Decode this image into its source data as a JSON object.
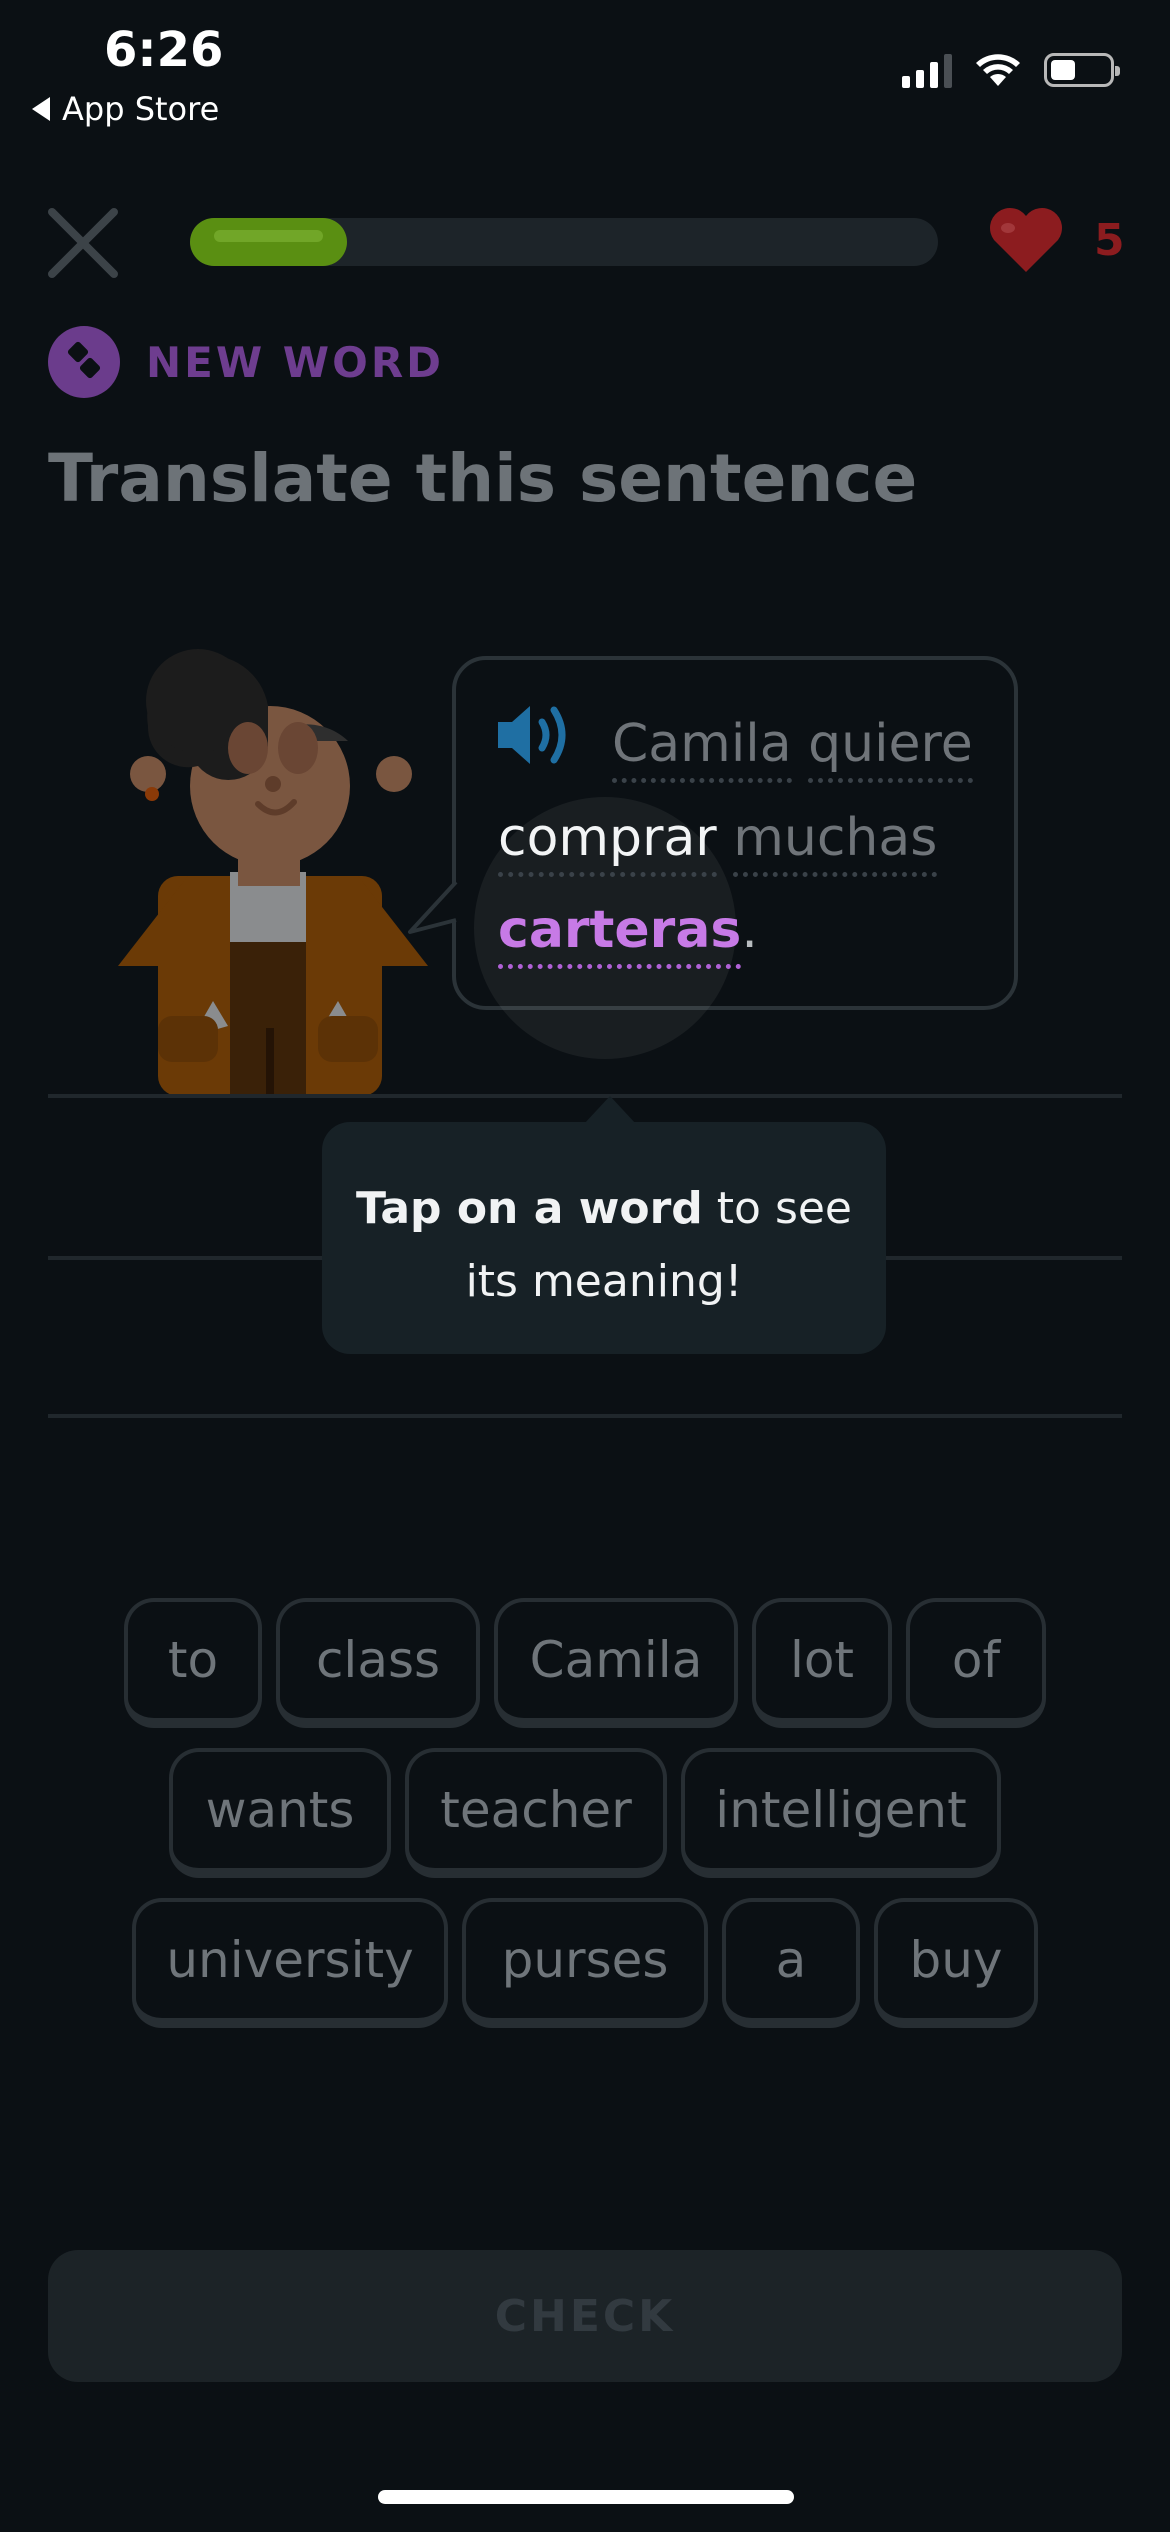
{
  "status_bar": {
    "time": "6:26",
    "back_label": "App Store",
    "icons": [
      "cellular-signal-icon",
      "wifi-icon",
      "battery-icon"
    ]
  },
  "header": {
    "close_icon": "close-icon",
    "progress_fraction": 0.21,
    "hearts_icon": "heart-icon",
    "hearts_count": "5"
  },
  "lesson": {
    "badge_icon": "new-word-icon",
    "badge_label": "NEW WORD",
    "title": "Translate this sentence"
  },
  "prompt": {
    "speaker_icon": "speaker-icon",
    "words": [
      "Camila",
      "quiere",
      "comprar",
      "muchas",
      "carteras"
    ],
    "punctuation": "."
  },
  "tooltip": {
    "bold": "Tap on a word",
    "rest_line1": " to see",
    "line2": "its meaning!"
  },
  "word_bank": [
    [
      "to",
      "class",
      "Camila",
      "lot",
      "of"
    ],
    [
      "wants",
      "teacher",
      "intelligent"
    ],
    [
      "university",
      "purses",
      "a",
      "buy"
    ]
  ],
  "check_label": "CHECK",
  "colors": {
    "progress": "#5a8f12",
    "heart": "#8c1c1f",
    "new_word": "#6e3d8f",
    "highlight_word": "#c77ae6",
    "speaker": "#1f6fa3"
  }
}
